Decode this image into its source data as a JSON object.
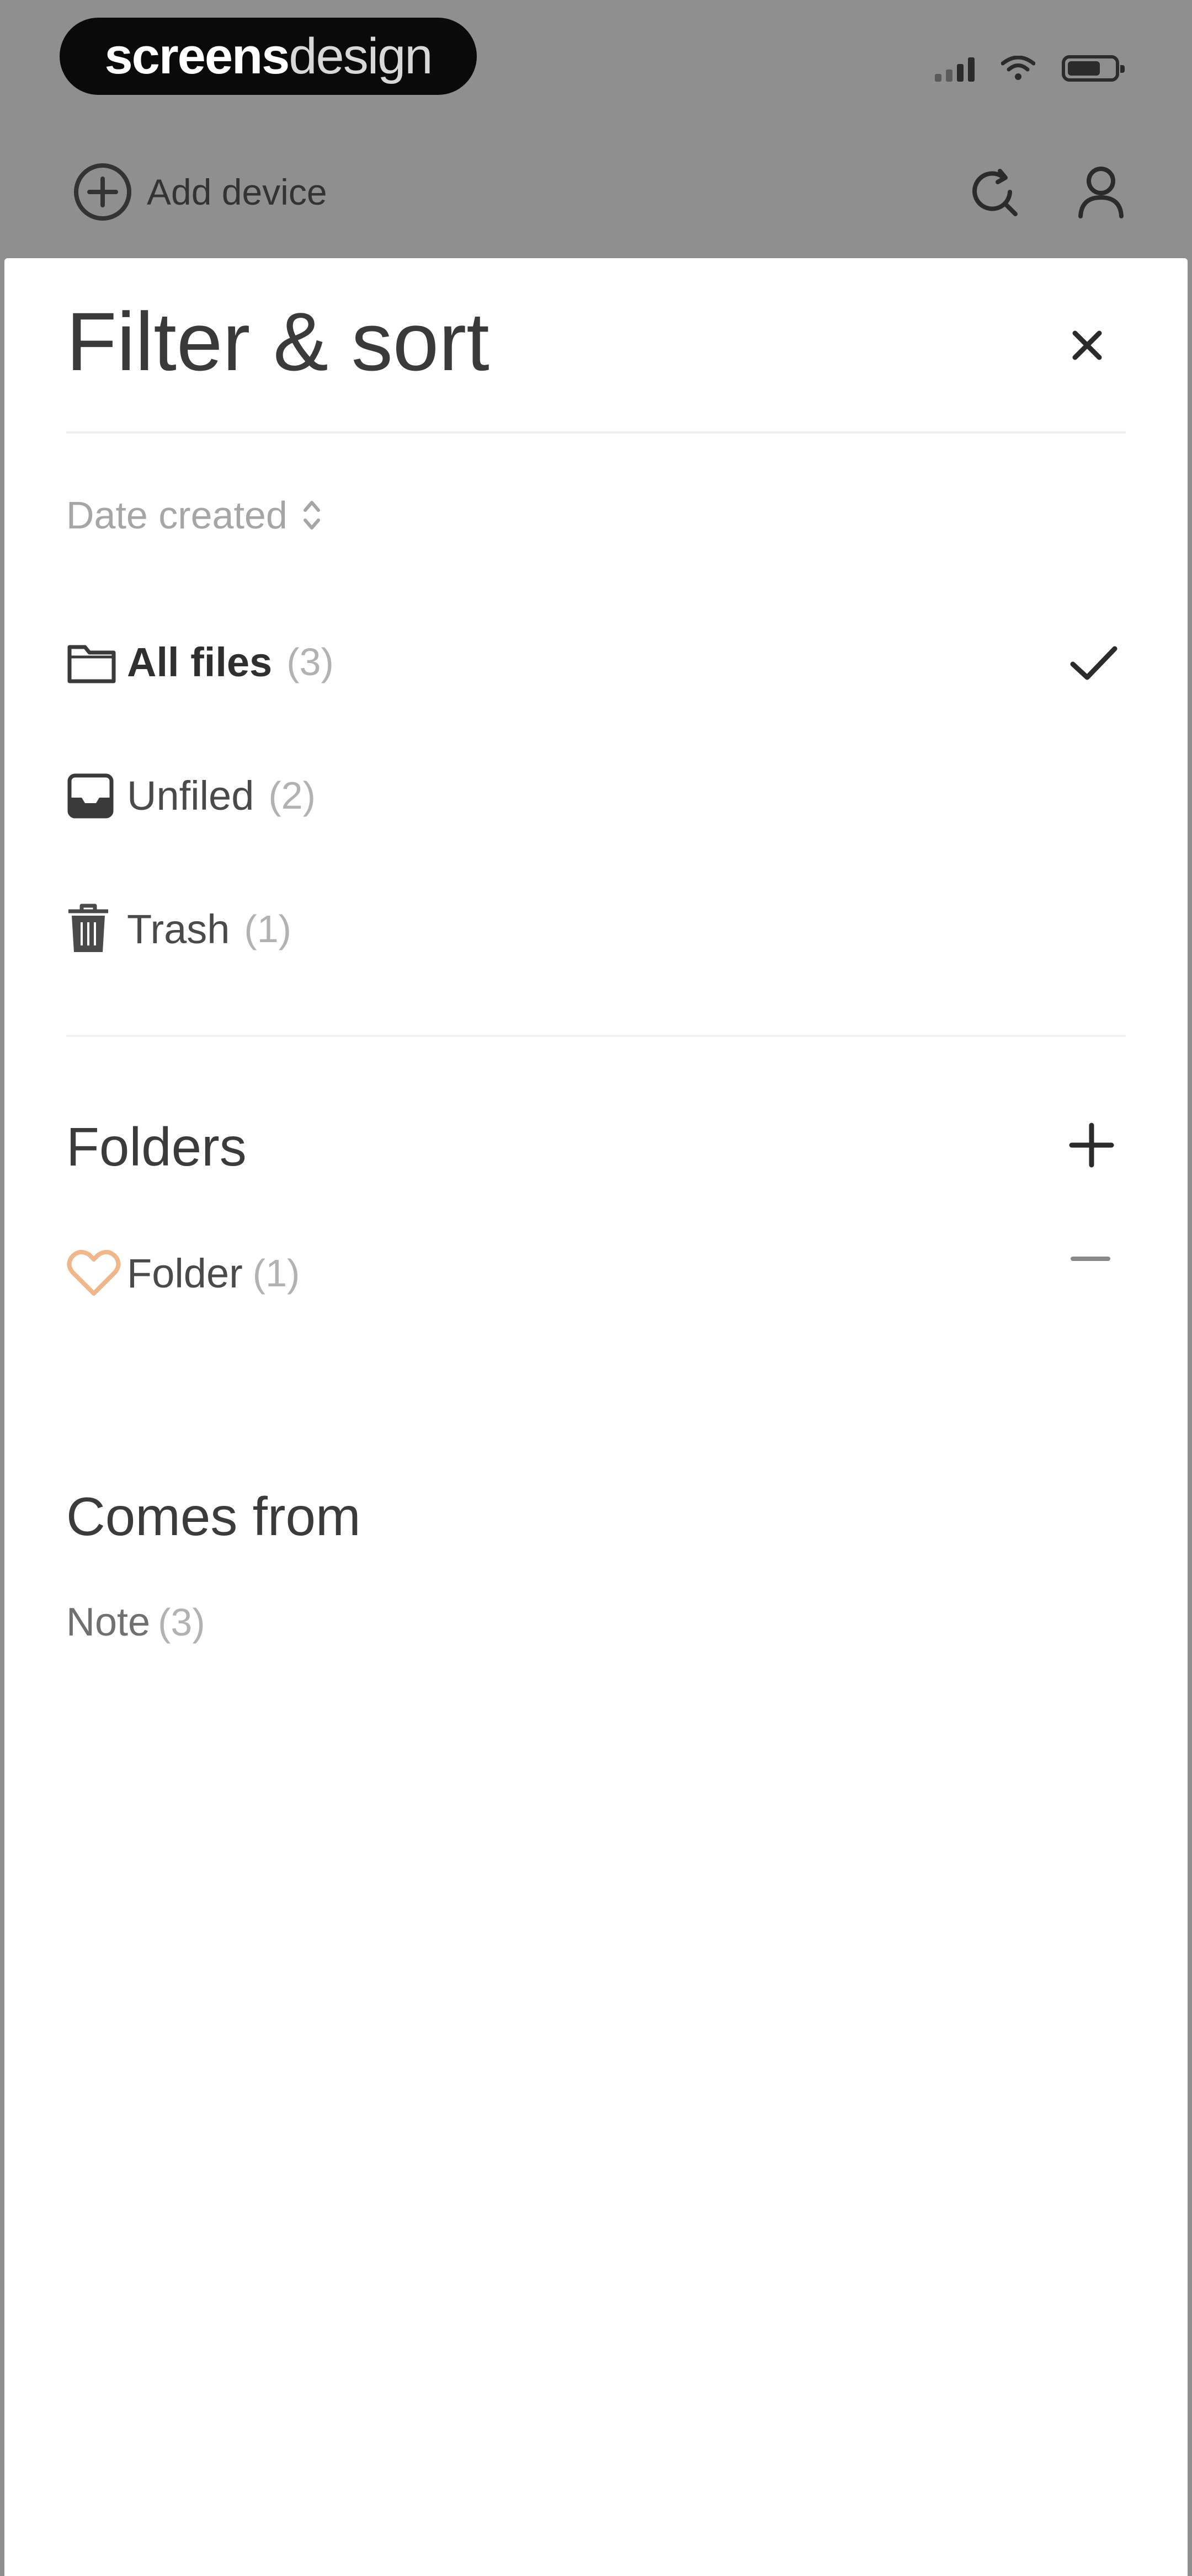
{
  "status_bar": {
    "brand_part1": "screens",
    "brand_part2": "design"
  },
  "header": {
    "add_device_label": "Add device"
  },
  "sheet": {
    "title": "Filter & sort",
    "sort_label": "Date created",
    "filters": [
      {
        "label": "All files",
        "count": "(3)",
        "selected": true,
        "icon": "folder-icon"
      },
      {
        "label": "Unfiled",
        "count": "(2)",
        "selected": false,
        "icon": "inbox-icon"
      },
      {
        "label": "Trash",
        "count": "(1)",
        "selected": false,
        "icon": "trash-icon"
      }
    ],
    "folders_heading": "Folders",
    "folders": [
      {
        "label": "Folder",
        "count": "(1)",
        "icon": "heart-icon",
        "icon_color": "#f0b88a"
      }
    ],
    "comes_from_heading": "Comes from",
    "sources": [
      {
        "label": "Note",
        "count": "(3)"
      }
    ]
  },
  "colors": {
    "backdrop": "#8f8f8f",
    "sheet_background": "#ffffff",
    "accent_heart": "#f0b88a",
    "text_primary": "#2b2b2b",
    "text_muted": "#b2b2b2"
  }
}
